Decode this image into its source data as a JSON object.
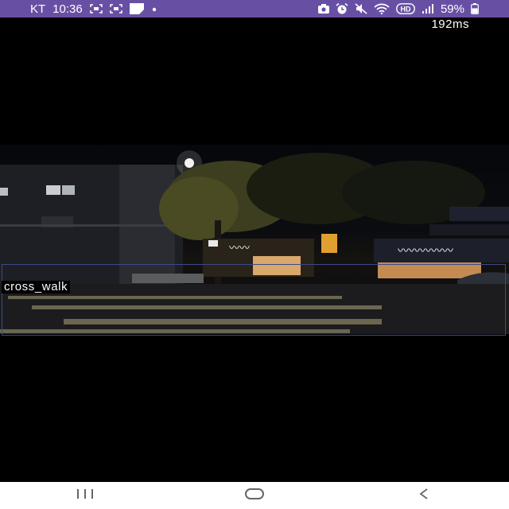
{
  "status_bar": {
    "carrier": "KT",
    "time": "10:36",
    "hd_badge": "HD",
    "battery_percent": "59%",
    "battery_level": 0.59,
    "icons_left": [
      "screenshot-icon",
      "screenshot-icon",
      "notification-icon",
      "dot-icon"
    ],
    "icons_right": [
      "camera-notify-icon",
      "alarm-icon",
      "mute-icon",
      "wifi-icon",
      "hd-icon",
      "signal-icon",
      "battery-icon"
    ]
  },
  "camera": {
    "latency": "192ms",
    "detections": [
      {
        "label": "cross_walk"
      }
    ]
  },
  "nav_bar": {
    "buttons": [
      "recent-apps-icon",
      "home-icon",
      "back-icon"
    ]
  },
  "colors": {
    "status_bar_bg": "#6750a4",
    "detection_box": "#3c4a88",
    "nav_bar_bg": "#ffffff"
  }
}
